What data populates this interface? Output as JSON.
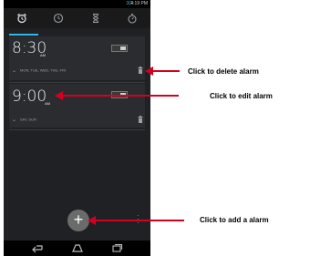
{
  "status_bar": {
    "network": "3G",
    "time": "4:19 PM"
  },
  "tabs": [
    {
      "icon": "alarm-clock-icon",
      "active": true
    },
    {
      "icon": "clock-icon",
      "active": false
    },
    {
      "icon": "hourglass-icon",
      "active": false
    },
    {
      "icon": "stopwatch-icon",
      "active": false
    }
  ],
  "alarms": [
    {
      "time": "8:30",
      "ampm": "AM",
      "days": "MON, TUE, WED, THU, FRI",
      "enabled": true
    },
    {
      "time": "9:00",
      "ampm": "AM",
      "days": "SAT, SUN",
      "enabled": true
    }
  ],
  "fab": {
    "label": "+"
  },
  "callouts": {
    "delete": "Click to delete alarm",
    "edit": "Click to edit alarm",
    "add": "Click to add a alarm"
  },
  "colors": {
    "accent": "#33b5e5",
    "arrow": "#d3001f",
    "background": "#202124"
  }
}
